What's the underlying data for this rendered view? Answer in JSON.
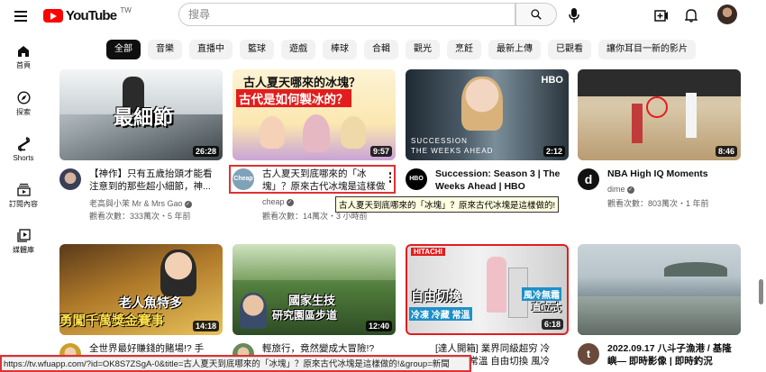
{
  "header": {
    "logo_text": "YouTube",
    "country_code": "TW",
    "search_placeholder": "搜尋"
  },
  "sidebar": {
    "items": [
      {
        "label": "首頁",
        "icon": "home-icon"
      },
      {
        "label": "探索",
        "icon": "explore-icon"
      },
      {
        "label": "Shorts",
        "icon": "shorts-icon"
      },
      {
        "label": "訂閱內容",
        "icon": "subscriptions-icon"
      },
      {
        "label": "媒體庫",
        "icon": "library-icon"
      }
    ]
  },
  "chips": [
    "全部",
    "音樂",
    "直播中",
    "籃球",
    "遊戲",
    "棒球",
    "合輯",
    "觀光",
    "烹飪",
    "最新上傳",
    "已觀看",
    "讓你耳目一新的影片"
  ],
  "videos": [
    {
      "title": "【神作】只有五歲抬頭才能看注意到的那些超小細節，神...",
      "channel": "老高與小茉 Mr & Mrs Gao",
      "meta": "觀看次數：333萬次・5 年前",
      "duration": "26:28",
      "thumb_text": "最細節",
      "bold": false
    },
    {
      "title": "古人夏天到底哪來的「冰塊」？原來古代冰塊是這樣做的!",
      "channel": "cheap",
      "meta": "觀看次數：14萬次・3 小時前",
      "duration": "9:57",
      "thumb_text": "古人夏天哪來的冰塊？",
      "thumb_text2": "古代是如何製冰的？",
      "avatar_text": "Cheap",
      "bold": false
    },
    {
      "title": "Succession: Season 3 | The Weeks Ahead | HBO",
      "channel": "",
      "meta": "",
      "duration": "2:12",
      "thumb_text": "SUCCESSION",
      "thumb_text2": "THE WEEKS AHEAD",
      "logo": "HBO",
      "avatar_text": "HBO",
      "bold": true
    },
    {
      "title": "NBA High IQ Moments",
      "channel": "dime",
      "meta": "觀看次數：803萬次・1 年前",
      "duration": "8:46",
      "avatar_text": "d",
      "bold": true
    },
    {
      "title": "全世界最好賺錢的賭場!? 手拿...",
      "channel": "",
      "meta": "",
      "duration": "14:18",
      "thumb_text": "老人魚特多",
      "thumb_text2": "勇闖千萬獎金賽事",
      "bold": false
    },
    {
      "title": "輕旅行，竟然變成大冒險!? 爾...",
      "channel": "",
      "meta": "",
      "duration": "12:40",
      "thumb_text": "國家生技",
      "thumb_text2": "研究園區步道",
      "bold": false
    },
    {
      "title": "[達人開箱] 業界同級超穷 冷凍/冷藏/常溫 自由切換 風冷無...",
      "channel": "",
      "meta": "",
      "duration": "6:18",
      "thumb_text": "自由切換",
      "thumb_text2": "冷凍 冷藏 常溫",
      "brand": "HITACHI",
      "badge": "風冷無霜",
      "badge2": "直立式",
      "bold": false
    },
    {
      "title": "2022.09.17 八斗子漁港 / 基隆嶼— 即時影像 | 即時釣況",
      "channel": "",
      "meta": "",
      "duration": "",
      "avatar_text": "t",
      "bold": true
    }
  ],
  "tooltip": "古人夏天到底哪來的「冰塊」？原來古代冰塊是這樣做的!",
  "status_url": "https://tv.wfuapp.com/?id=OK8S7ZSgA-0&title=古人夏天到底哪來的「冰塊」？原來古代冰塊是這樣做的!&group=新聞",
  "colors": {
    "brand_red": "#ff0000",
    "highlight": "#e03131",
    "text_secondary": "#606060"
  }
}
